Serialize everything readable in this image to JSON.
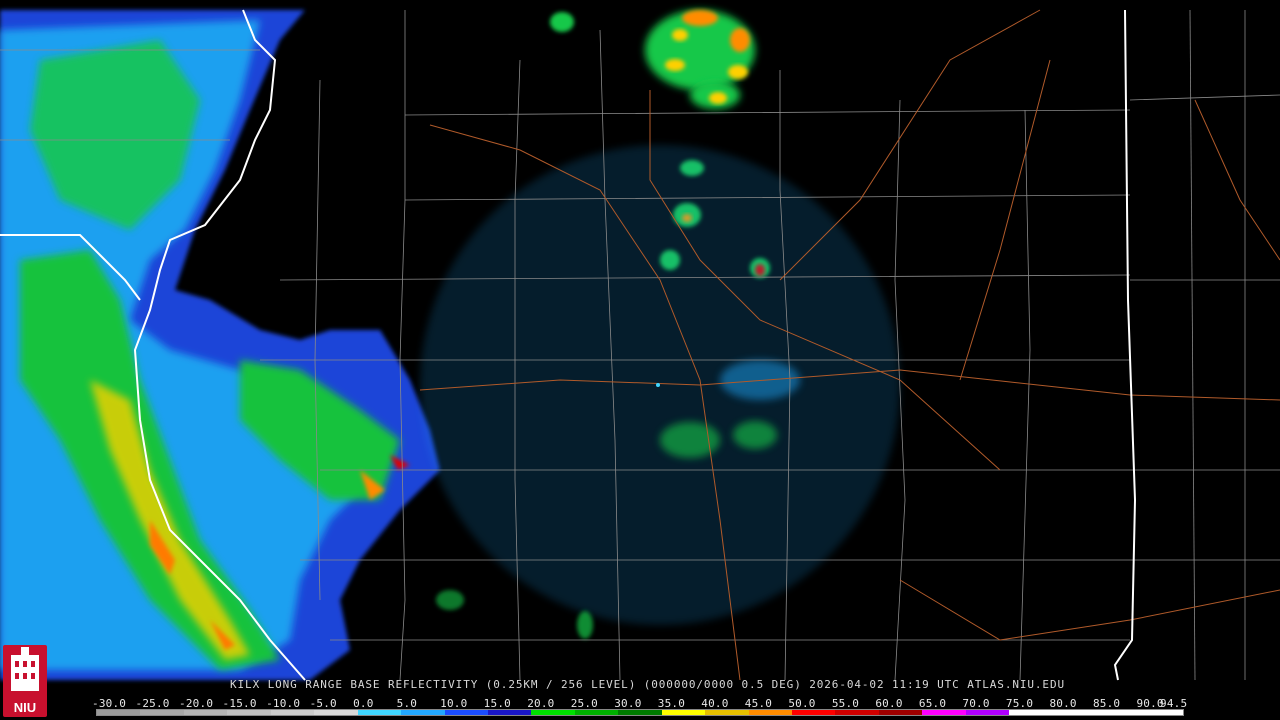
{
  "caption": "KILX LONG RANGE BASE REFLECTIVITY (0.25KM / 256 LEVEL) (000000/0000 0.5 DEG) 2026-04-02 11:19 UTC  ATLAS.NIU.EDU",
  "logo_label": "NIU",
  "scale": {
    "labels": [
      "-30.0",
      "-25.0",
      "-20.0",
      "-15.0",
      "-10.0",
      "-5.0",
      "0.0",
      "5.0",
      "10.0",
      "15.0",
      "20.0",
      "25.0",
      "30.0",
      "35.0",
      "40.0",
      "45.0",
      "50.0",
      "55.0",
      "60.0",
      "65.0",
      "70.0",
      "75.0",
      "80.0",
      "85.0",
      "90.0",
      "94.5"
    ],
    "colors": [
      "#9a9a9a",
      "#a8a8a8",
      "#b4b4b4",
      "#c0c0c0",
      "#cccccc",
      "#d8d8d8",
      "#3fd6ff",
      "#22a8ff",
      "#1b4dff",
      "#1a16c8",
      "#00e000",
      "#00b000",
      "#007a00",
      "#ffff00",
      "#e6c000",
      "#ff8c00",
      "#ff0000",
      "#d00000",
      "#a00000",
      "#ff00ff",
      "#b000ff",
      "#ffffff",
      "#ffffff",
      "#ffffff",
      "#ffffff"
    ]
  },
  "colors": {
    "state_border": "#ffffff",
    "county_line": "#8a8a8a",
    "highway": "#b05a2a",
    "background": "#000000"
  }
}
